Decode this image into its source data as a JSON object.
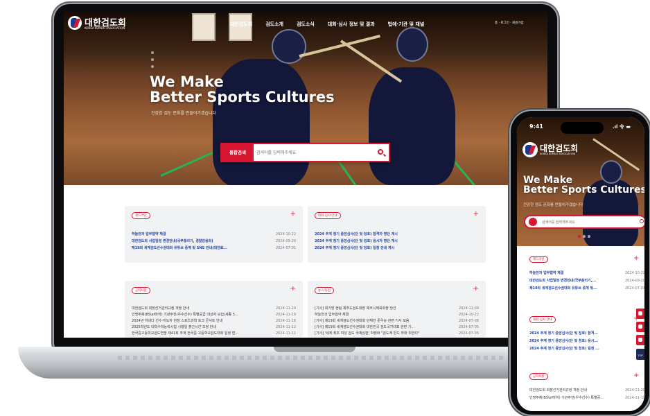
{
  "laptop": {
    "nav": {
      "logo_text": "대한검도회",
      "logo_sub": "KOREA KUMDO ASSOCIATION",
      "menu": [
        "대한검도회",
        "검도소개",
        "검도소식",
        "대회·심사 정보 및 결과",
        "법에·기관 및 재널"
      ],
      "util": "홈 · 로그인 · 회원가입"
    },
    "hero": {
      "title_line1": "We Make",
      "title_line2": "Better Sports Cultures",
      "subtitle": "건강한 검도 문화를 만들어가겠습니다",
      "search_label": "통합검색",
      "search_placeholder": "검색어를 입력해주세요"
    },
    "panels": [
      {
        "tag": "헤드라인",
        "style": "blue",
        "rows": [
          {
            "title": "하늘안과 업무협약 체결",
            "date": "2024-10-22"
          },
          {
            "title": "대한검도회 사업일정 변경안내(국무총리기, 경찰감용회)",
            "date": "2024-09-20"
          },
          {
            "title": "제19회 세계검도선수권대회 유튜브 중계 및 SNS 안내(대전료...",
            "date": "2024-07-01"
          }
        ]
      },
      {
        "tag": "대회·심사 안내",
        "style": "blue",
        "rows": [
          {
            "title": "2024 추계 정기 중앙심사(단 및 칭호) 합격자 명단 게시",
            "date": ""
          },
          {
            "title": "2024 추계 정기 중앙심사(단 및 칭호) 응시자 명단 게시",
            "date": ""
          },
          {
            "title": "2024 추계 정기 중앙심사(단 및 칭호) 일정 안내 게시",
            "date": ""
          }
        ]
      },
      {
        "tag": "공지사항",
        "style": "gray",
        "rows": [
          {
            "title": "대한검도회 회장선거관리규정 개정 안내",
            "date": "2024-11-20"
          },
          {
            "title": "인명주제(BS\\ef마하) 기관주천(우수선수) 특별공급 대상자 모집(세종 5...",
            "date": "2024-11-19"
          },
          {
            "title": "2024년 하네다 선수·지도자 현장 스포츠과학 토크 콘서트 안내",
            "date": "2024-11-18"
          },
          {
            "title": "2025학년도 대학수학능력시험 시행일 출근시간 조정 안내",
            "date": "2024-11-12"
          },
          {
            "title": "한국중고등학교검도연맹 제41회 추계 전국중·고등학교검도대회 일정 변...",
            "date": "2024-11-11"
          }
        ]
      },
      {
        "tag": "뉴스/동정",
        "style": "gray",
        "rows": [
          {
            "title": "[기사] 회기방 현팀 제주도검도회장 제주시체육회장 당선",
            "date": "2024-11-09"
          },
          {
            "title": "하늘안과 업무협약 체결",
            "date": "2024-10-22"
          },
          {
            "title": "[기사] 제19회 세계검도선수권대회 단체전 준우승 관련 기사 모음",
            "date": "2024-07-08"
          },
          {
            "title": "[기사] 제19회 세계검도선수권대회 대한민국 검도국가대표 관련 기...",
            "date": "2024-07-05"
          },
          {
            "title": "[기사] '세계 최초 여성 검도 국제심판' 박정화 \"검도계 반드 주파 위한다\"",
            "date": "2024-07-05"
          }
        ]
      }
    ]
  },
  "phone": {
    "time": "9:41",
    "status": ".ıl 令 ▬",
    "logo_text": "대한검도회",
    "logo_sub": "KOREA KUMDO ASSOCIATION",
    "hero_line1": "We Make",
    "hero_line2": "Better Sports Cultures",
    "hero_sub": "건강한 검도 문화를 만들어가겠습니다",
    "search_placeholder": "검색어를 입력해주세요",
    "sections": [
      {
        "tag": "헤드라인",
        "style": "blue",
        "rows": [
          {
            "title": "하늘안과 업무협약 체결",
            "date": "2024-10-22"
          },
          {
            "title": "대한검도회 사업일정 변경안내(국무총리기,...",
            "date": "2024-09-20"
          },
          {
            "title": "제19회 세계검도선수권대회 유튜브 중계 및...",
            "date": "2024-07-01"
          }
        ]
      },
      {
        "tag": "대회·심사 안내",
        "style": "blue",
        "rows": [
          {
            "title": "2024 추계 정기 중앙심사(단 및 칭호) 합격...",
            "date": ""
          },
          {
            "title": "2024 추계 정기 중앙심사(단 및 칭호) 응시...",
            "date": ""
          },
          {
            "title": "2024 추계 정기 중앙심사(단 및 칭호) 일정 ...",
            "date": ""
          }
        ]
      },
      {
        "tag": "공지사항",
        "style": "gray",
        "rows": [
          {
            "title": "대한검도회 회장선거관리규정 개정 안내",
            "date": "2024-11-20"
          },
          {
            "title": "인명주제(BS\\ef마하) 기관주천(우수선수) 특별공...",
            "date": "2024-11-19"
          }
        ]
      }
    ],
    "sidebar_top": "TOP",
    "sidebar_icons": [
      "youtube-icon",
      "instagram-icon",
      "facebook-icon"
    ]
  },
  "colors": {
    "accent": "#d7172f",
    "link_blue": "#1f3fa3",
    "panel_bg": "#f1f2f4"
  }
}
